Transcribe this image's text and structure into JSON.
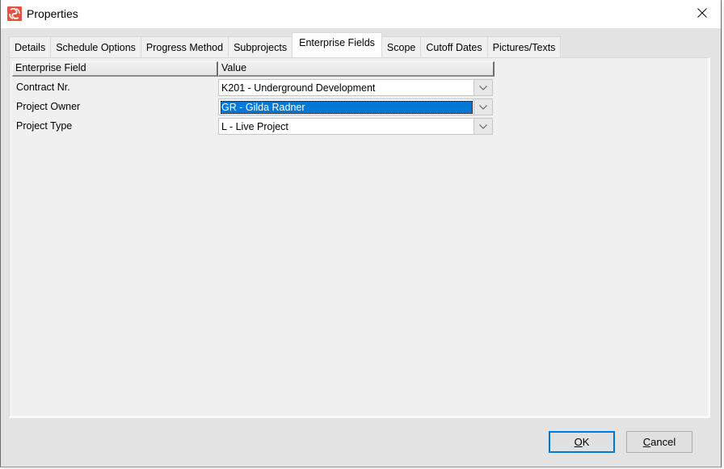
{
  "window": {
    "title": "Properties",
    "icon": "app-logo-icon",
    "close_icon": "close-icon"
  },
  "tabs": [
    {
      "label": "Details",
      "active": false
    },
    {
      "label": "Schedule Options",
      "active": false
    },
    {
      "label": "Progress Method",
      "active": false
    },
    {
      "label": "Subprojects",
      "active": false
    },
    {
      "label": "Enterprise Fields",
      "active": true
    },
    {
      "label": "Scope",
      "active": false
    },
    {
      "label": "Cutoff Dates",
      "active": false
    },
    {
      "label": "Pictures/Texts",
      "active": false
    }
  ],
  "grid": {
    "columns": [
      "Enterprise Field",
      "Value"
    ],
    "rows": [
      {
        "field": "Contract Nr.",
        "value": "K201 - Underground Development",
        "selected": false
      },
      {
        "field": "Project Owner",
        "value": "GR - Gilda Radner",
        "selected": true
      },
      {
        "field": "Project Type",
        "value": "L - Live Project",
        "selected": false
      }
    ]
  },
  "buttons": {
    "ok": {
      "mnemonic": "O",
      "rest": "K"
    },
    "cancel": {
      "mnemonic": "C",
      "rest": "ancel"
    }
  },
  "colors": {
    "selection": "#0078d7",
    "icon_red": "#e8503f"
  }
}
